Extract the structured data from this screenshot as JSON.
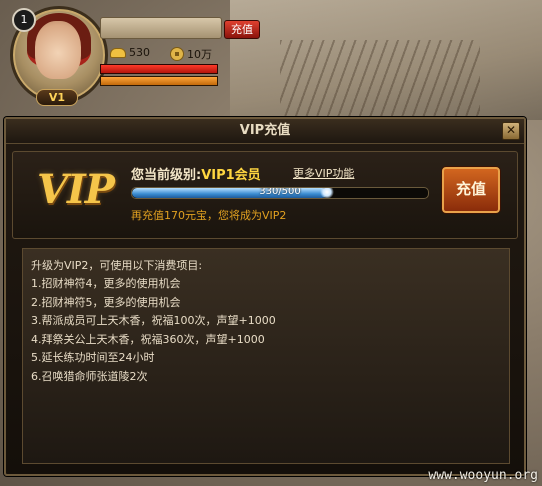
{
  "hud": {
    "player_level": "1",
    "vip_tag": "V1",
    "recharge_label": "充值",
    "gold_amount": "530",
    "coin_amount": "10万",
    "hp_fraction": 1.0,
    "mp_fraction": 1.0
  },
  "dialog": {
    "title": "VIP充值",
    "close_symbol": "✕",
    "vip_logo": "VIP",
    "current_level_label": "您当前级别:",
    "current_level_value": "VIP1会员",
    "more_link": "更多VIP功能",
    "progress_current": 330,
    "progress_max": 500,
    "progress_text": "330/500",
    "hint": "再充值170元宝，您将成为VIP2",
    "recharge_button": "充值",
    "benefits_heading": "升级为VIP2，可使用以下消费项目:",
    "benefits": [
      "1.招财神符4，更多的使用机会",
      "2.招财神符5，更多的使用机会",
      "3.帮派成员可上天木香，祝福100次，声望+1000",
      "4.拜祭关公上天木香，祝福360次，声望+1000",
      "5.延长练功时间至24小时",
      "6.召唤猎命师张道陵2次"
    ]
  },
  "watermark": "www.wooyun.org",
  "colors": {
    "gold_text": "#ffd640",
    "hint_text": "#e0a020",
    "recharge_button": "#c2561a",
    "progress_fill": "#3a8bd0"
  },
  "icons": [
    "gold-ingot-icon",
    "coin-icon",
    "close-icon"
  ]
}
